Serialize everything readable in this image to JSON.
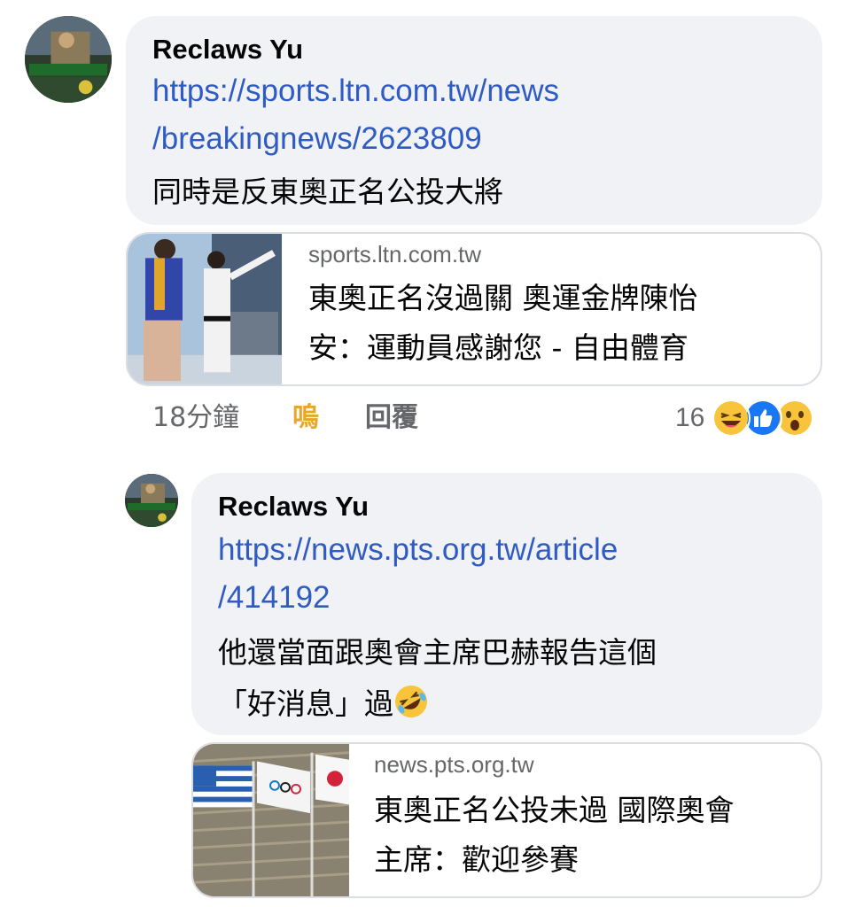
{
  "comment1": {
    "author": "Reclaws Yu",
    "link_line1": "https://sports.ltn.com.tw/news",
    "link_line2": "/breakingnews/2623809",
    "text": "同時是反東奧正名公投大將",
    "preview": {
      "domain": "sports.ltn.com.tw",
      "title_line1": "東奧正名沒過關 奧運金牌陳怡",
      "title_line2": "安：運動員感謝您 - 自由體育"
    },
    "meta": {
      "time": "18分鐘",
      "like": "嗚",
      "reply": "回覆",
      "reaction_count": "16",
      "reactions": [
        "haha-icon",
        "like-icon",
        "wow-icon"
      ]
    }
  },
  "reply1": {
    "author": "Reclaws Yu",
    "link_line1": "https://news.pts.org.tw/article",
    "link_line2": "/414192",
    "text_line1": "他還當面跟奧會主席巴赫報告這個",
    "text_line2": "「好消息」過",
    "text_emoji": "rolling-laughing-emoji",
    "preview": {
      "domain": "news.pts.org.tw",
      "title_line1": "東奧正名公投未過 國際奧會",
      "title_line2": "主席：歡迎參賽"
    }
  },
  "colors": {
    "link": "#2f5bc4",
    "bubble_bg": "#f0f2f5",
    "secondary_text": "#65676b",
    "reacted_like": "#e6a72a"
  }
}
